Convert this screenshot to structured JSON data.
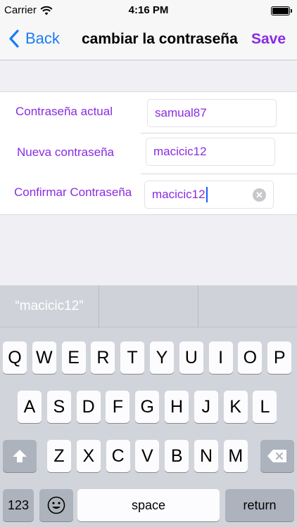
{
  "status_bar": {
    "carrier": "Carrier",
    "time": "4:16 PM"
  },
  "nav": {
    "back_label": "Back",
    "title": "cambiar la contraseña",
    "save_label": "Save"
  },
  "form": {
    "current_password": {
      "label": "Contraseña actual",
      "value": "samual87"
    },
    "new_password": {
      "label": "Nueva contraseña",
      "value": "macicic12"
    },
    "confirm_password": {
      "label": "Confirmar Contraseña",
      "value": "macicic12"
    }
  },
  "keyboard": {
    "suggestion": "“macicic12”",
    "row1": [
      "Q",
      "W",
      "E",
      "R",
      "T",
      "Y",
      "U",
      "I",
      "O",
      "P"
    ],
    "row2": [
      "A",
      "S",
      "D",
      "F",
      "G",
      "H",
      "J",
      "K",
      "L"
    ],
    "row3": [
      "Z",
      "X",
      "C",
      "V",
      "B",
      "N",
      "M"
    ],
    "numbers_label": "123",
    "space_label": "space",
    "return_label": "return"
  },
  "colors": {
    "accent": "#8a2be2",
    "link": "#1a7cf5"
  },
  "icons": [
    "wifi-icon",
    "battery-icon",
    "chevron-left-icon",
    "clear-icon",
    "shift-icon",
    "delete-icon",
    "emoji-icon"
  ]
}
